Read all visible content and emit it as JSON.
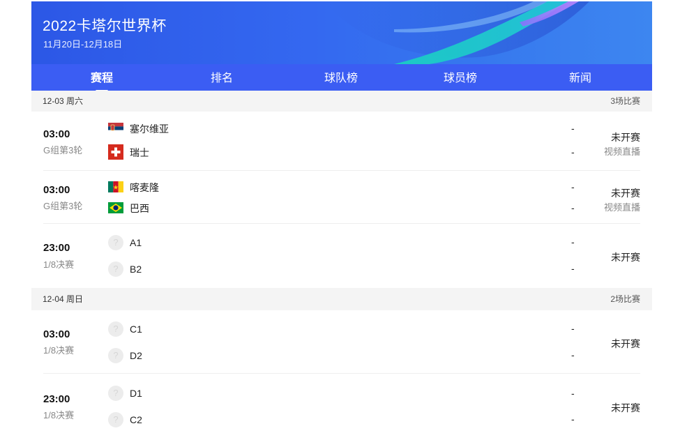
{
  "header": {
    "title": "2022卡塔尔世界杯",
    "dates": "11月20日-12月18日"
  },
  "tabs": [
    {
      "label": "赛程",
      "active": true
    },
    {
      "label": "排名",
      "active": false
    },
    {
      "label": "球队榜",
      "active": false
    },
    {
      "label": "球员榜",
      "active": false
    },
    {
      "label": "新闻",
      "active": false
    }
  ],
  "days": [
    {
      "date": "12-03 周六",
      "count": "3场比赛",
      "matches": [
        {
          "time": "03:00",
          "stage": "G组第3轮",
          "home": {
            "name": "塞尔维亚",
            "flag": "serbia-flag"
          },
          "away": {
            "name": "瑞士",
            "flag": "switzerland-flag"
          },
          "home_score": "-",
          "away_score": "-",
          "status": "未开赛",
          "live": "视频直播"
        },
        {
          "time": "03:00",
          "stage": "G组第3轮",
          "home": {
            "name": "喀麦隆",
            "flag": "cameroon-flag"
          },
          "away": {
            "name": "巴西",
            "flag": "brazil-flag"
          },
          "home_score": "-",
          "away_score": "-",
          "status": "未开赛",
          "live": "视频直播"
        },
        {
          "time": "23:00",
          "stage": "1/8决赛",
          "home": {
            "name": "A1",
            "flag": "placeholder-icon"
          },
          "away": {
            "name": "B2",
            "flag": "placeholder-icon"
          },
          "home_score": "-",
          "away_score": "-",
          "status": "未开赛"
        }
      ]
    },
    {
      "date": "12-04 周日",
      "count": "2场比赛",
      "matches": [
        {
          "time": "03:00",
          "stage": "1/8决赛",
          "home": {
            "name": "C1",
            "flag": "placeholder-icon"
          },
          "away": {
            "name": "D2",
            "flag": "placeholder-icon"
          },
          "home_score": "-",
          "away_score": "-",
          "status": "未开赛"
        },
        {
          "time": "23:00",
          "stage": "1/8决赛",
          "home": {
            "name": "D1",
            "flag": "placeholder-icon"
          },
          "away": {
            "name": "C2",
            "flag": "placeholder-icon"
          },
          "home_score": "-",
          "away_score": "-",
          "status": "未开赛"
        }
      ]
    }
  ],
  "placeholder_glyph": "?",
  "colors": {
    "banner": "#3468f0",
    "tab_bar": "#3b5df3",
    "day_header_bg": "#f4f4f4"
  }
}
